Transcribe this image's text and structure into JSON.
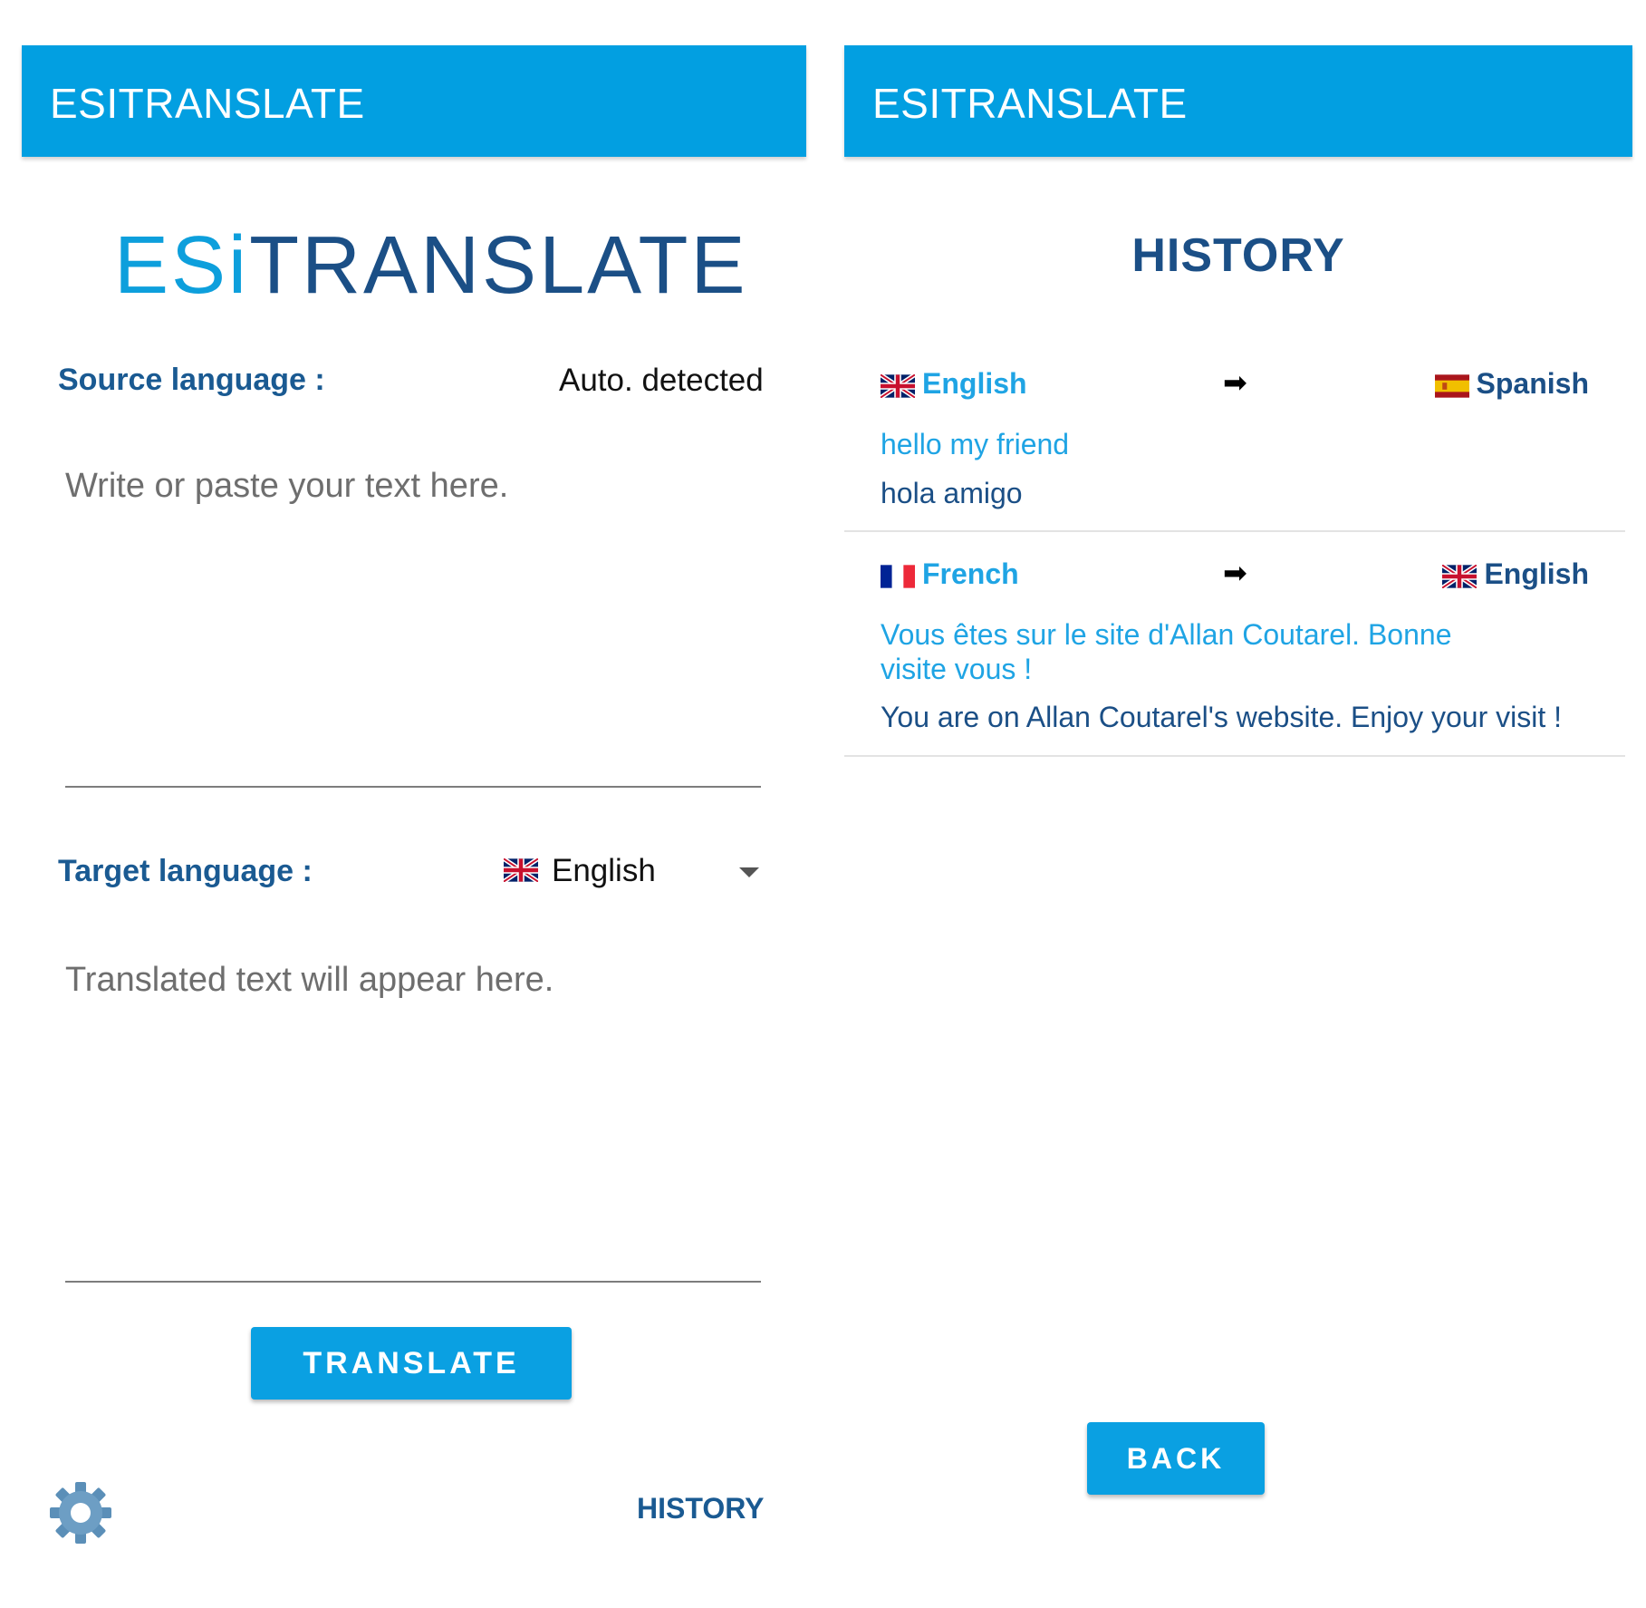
{
  "main": {
    "appbar_title": "ESITRANSLATE",
    "logo": {
      "part1": "ESi",
      "part2": "TRANSLATE"
    },
    "source_label": "Source language :",
    "source_value": "Auto. detected",
    "input_placeholder": "Write or paste your text here.",
    "target_label": "Target language :",
    "target_value": "English",
    "target_flag": "uk-flag-icon",
    "output_placeholder": "Translated text will appear here.",
    "translate_button": "TRANSLATE",
    "settings_icon": "gear-icon",
    "history_link": "HISTORY"
  },
  "history": {
    "appbar_title": "ESITRANSLATE",
    "title": "HISTORY",
    "entries": [
      {
        "from": "English",
        "from_flag": "uk-flag-icon",
        "arrow": "➡",
        "to": "Spanish",
        "to_flag": "spain-flag-icon",
        "source": "hello my friend",
        "translation": "hola amigo"
      },
      {
        "from": "French",
        "from_flag": "france-flag-icon",
        "arrow": "➡",
        "to": "English",
        "to_flag": "uk-flag-icon",
        "source": "Vous êtes sur le site d'Allan Coutarel. Bonne visite vous !",
        "translation": "You are on Allan Coutarel's website. Enjoy your visit !"
      }
    ],
    "back_button": "BACK"
  },
  "colors": {
    "appbar": "#029fe1",
    "primary_dark": "#1b4f86",
    "accent": "#1fa4e4",
    "button": "#0aa0e2"
  }
}
